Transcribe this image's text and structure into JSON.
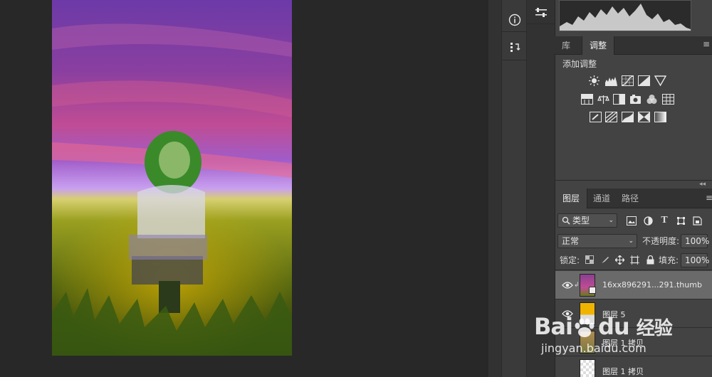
{
  "adjustments_panel": {
    "tabs": [
      {
        "label": "库",
        "active": false
      },
      {
        "label": "调整",
        "active": true
      }
    ],
    "heading": "添加调整"
  },
  "layers_panel": {
    "tabs": [
      {
        "label": "图层",
        "active": true
      },
      {
        "label": "通道",
        "active": false
      },
      {
        "label": "路径",
        "active": false
      }
    ],
    "filter_kind": "类型",
    "blend_mode": "正常",
    "opacity_label": "不透明度:",
    "opacity_value": "100%",
    "lock_label": "锁定:",
    "fill_label": "填充:",
    "fill_value": "100%",
    "layers": [
      {
        "name": "16xx896291...291.thumb",
        "selected": true,
        "thumb_color": "#8a3f8f"
      },
      {
        "name": "图层 5",
        "selected": false,
        "thumb_color": "#f0b400"
      },
      {
        "name": "图层 1 拷贝",
        "selected": false,
        "thumb_color": "#7a7a40"
      },
      {
        "name": "图层 1 拷贝",
        "selected": false,
        "thumb_color": "#dddddd"
      }
    ]
  },
  "watermark": {
    "brand": "Bai",
    "brand2": "du",
    "brand_cn": "经验",
    "site": "jingyan.baidu.com"
  },
  "colors": {
    "panel_bg": "#434343",
    "workspace_bg": "#282828",
    "selected_layer": "#6a6a6a"
  }
}
